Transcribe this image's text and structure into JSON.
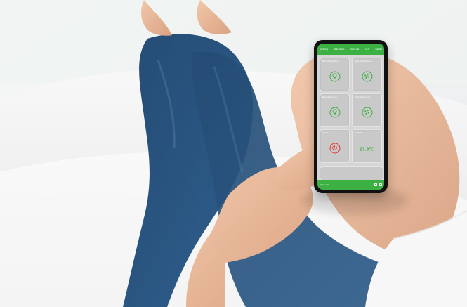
{
  "phone": {
    "tabs": [
      "Hệ thống",
      "Điều khiển",
      "Giám sát",
      "Lịch",
      "Cài đặt"
    ],
    "tiles": [
      {
        "title": "Đèn phòng khách",
        "icon": "bulb-icon",
        "accent": "#3cb043"
      },
      {
        "title": "Quạt phòng khách",
        "icon": "fan-icon",
        "accent": "#3cb043"
      },
      {
        "title": "Đèn phòng ngủ",
        "icon": "bulb-icon",
        "accent": "#3cb043"
      },
      {
        "title": "Quạt phòng ngủ",
        "icon": "fan-icon",
        "accent": "#3cb043"
      },
      {
        "title": "Ổ cắm",
        "icon": "power-icon",
        "accent": "#e53935"
      },
      {
        "title": "Nhiệt độ",
        "value": "23.3°C",
        "accent": "#3cb043"
      }
    ],
    "bottom": {
      "label": "Đăng xuất",
      "icons": [
        "settings-icon",
        "info-icon"
      ]
    }
  }
}
